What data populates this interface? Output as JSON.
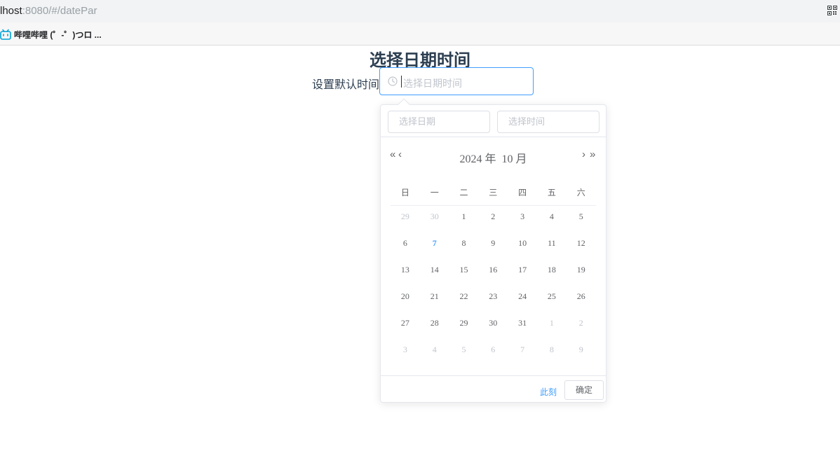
{
  "browser": {
    "url_host": "lhost",
    "url_path": ":8080/#/datePar",
    "bookmark_label": "哔哩哔哩 (゜-゜)つロ ..."
  },
  "page": {
    "title": "选择日期时间",
    "form_label": "设置默认时间",
    "input_placeholder": "选择日期时间"
  },
  "picker": {
    "date_placeholder": "选择日期",
    "time_placeholder": "选择时间",
    "nav": {
      "prev_year": "«",
      "prev_month": "‹",
      "next_month": "›",
      "next_year": "»"
    },
    "year_label": "2024 年",
    "month_label": "10 月",
    "weekdays": [
      "日",
      "一",
      "二",
      "三",
      "四",
      "五",
      "六"
    ],
    "weeks": [
      [
        {
          "d": "29",
          "o": true
        },
        {
          "d": "30",
          "o": true
        },
        {
          "d": "1"
        },
        {
          "d": "2"
        },
        {
          "d": "3"
        },
        {
          "d": "4"
        },
        {
          "d": "5"
        }
      ],
      [
        {
          "d": "6"
        },
        {
          "d": "7",
          "t": true
        },
        {
          "d": "8"
        },
        {
          "d": "9"
        },
        {
          "d": "10"
        },
        {
          "d": "11"
        },
        {
          "d": "12"
        }
      ],
      [
        {
          "d": "13"
        },
        {
          "d": "14"
        },
        {
          "d": "15"
        },
        {
          "d": "16"
        },
        {
          "d": "17"
        },
        {
          "d": "18"
        },
        {
          "d": "19"
        }
      ],
      [
        {
          "d": "20"
        },
        {
          "d": "21"
        },
        {
          "d": "22"
        },
        {
          "d": "23"
        },
        {
          "d": "24"
        },
        {
          "d": "25"
        },
        {
          "d": "26"
        }
      ],
      [
        {
          "d": "27"
        },
        {
          "d": "28"
        },
        {
          "d": "29"
        },
        {
          "d": "30"
        },
        {
          "d": "31"
        },
        {
          "d": "1",
          "o": true
        },
        {
          "d": "2",
          "o": true
        }
      ],
      [
        {
          "d": "3",
          "o": true
        },
        {
          "d": "4",
          "o": true
        },
        {
          "d": "5",
          "o": true
        },
        {
          "d": "6",
          "o": true
        },
        {
          "d": "7",
          "o": true
        },
        {
          "d": "8",
          "o": true
        },
        {
          "d": "9",
          "o": true
        }
      ]
    ],
    "now_label": "此刻",
    "confirm_label": "确定"
  },
  "colors": {
    "accent": "#409eff",
    "text": "#606266",
    "muted": "#c0c4cc",
    "title": "#2c3e50"
  }
}
